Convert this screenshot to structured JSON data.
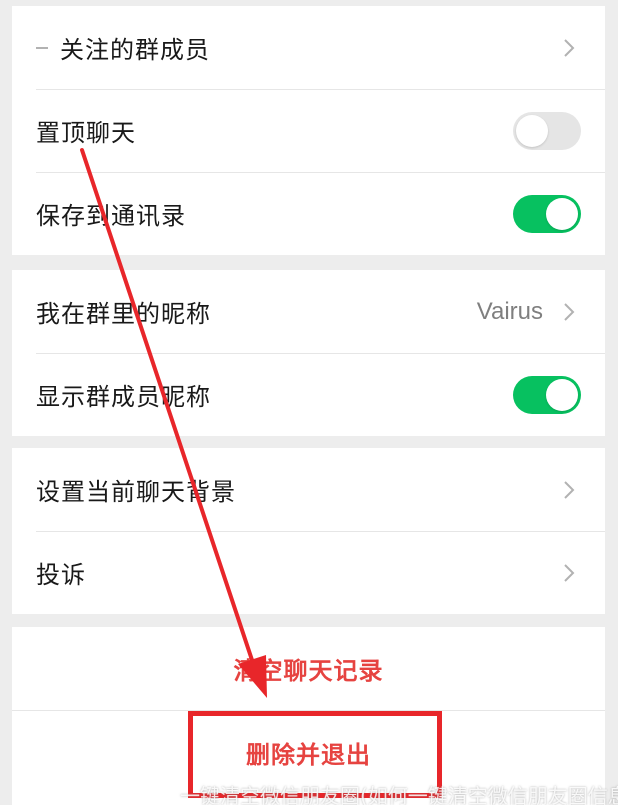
{
  "group1": {
    "rows": [
      {
        "label": "关注的群成员"
      },
      {
        "label": "置顶聊天",
        "toggle": "off"
      },
      {
        "label": "保存到通讯录",
        "toggle": "on"
      }
    ]
  },
  "group2": {
    "rows": [
      {
        "label": "我在群里的昵称",
        "value": "Vairus"
      },
      {
        "label": "显示群成员昵称",
        "toggle": "on"
      }
    ]
  },
  "group3": {
    "rows": [
      {
        "label": "设置当前聊天背景"
      },
      {
        "label": "投诉"
      }
    ]
  },
  "actions": {
    "clear_history": "清空聊天记录",
    "delete_exit": "删除并退出"
  },
  "watermark": "一键清空微信朋友圈(如何一键清空微信朋友圈信息)",
  "colors": {
    "toggle_on": "#07c160",
    "toggle_off": "#e5e5e5",
    "danger": "#e64340",
    "annotation": "#e8262a"
  },
  "icons": {
    "row_arrow": "chevron-right-icon"
  }
}
